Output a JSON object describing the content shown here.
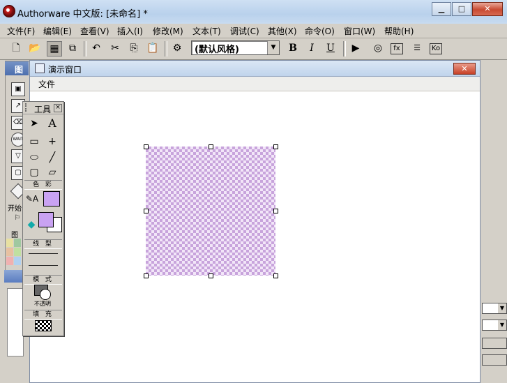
{
  "app": {
    "title": "Authorware 中文版: [未命名] *",
    "window_buttons": [
      "▁",
      "□",
      "✕"
    ]
  },
  "menubar": {
    "items": [
      "文件(F)",
      "编辑(E)",
      "查看(V)",
      "插入(I)",
      "修改(M)",
      "文本(T)",
      "调试(C)",
      "其他(X)",
      "命令(O)",
      "窗口(W)",
      "帮助(H)"
    ]
  },
  "toolbar": {
    "style_value": "(默认风格)",
    "bold": "B",
    "italic": "I",
    "underline": "U"
  },
  "icon_palette": {
    "title": "图"
  },
  "presentation": {
    "title": "演示窗口",
    "menu_file": "文件",
    "close": "✕"
  },
  "tools_panel": {
    "title": "工具",
    "text_tool": "A",
    "color_label": "色 彩",
    "line_label": "线 型",
    "mode_label": "模 式",
    "mode_value": "不透明",
    "fill_label": "填 充",
    "fill_color": "#c9a2f2"
  },
  "side_labels": {
    "start": "开始",
    "figure": "图"
  }
}
